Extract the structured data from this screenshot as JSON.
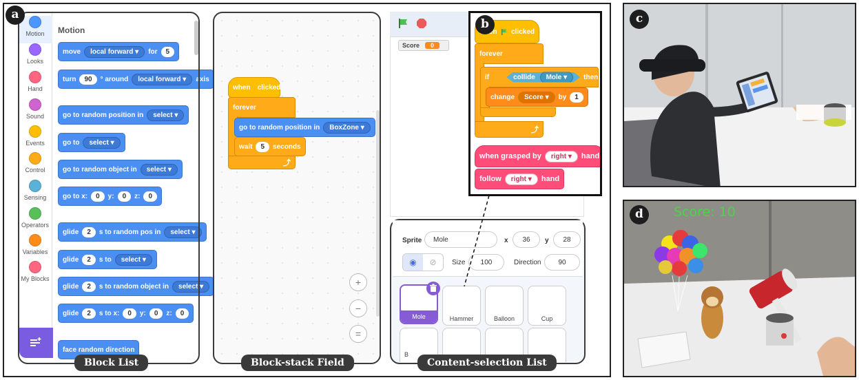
{
  "labels": {
    "a": "a",
    "b": "b",
    "c": "c",
    "d": "d",
    "block_list": "Block List",
    "block_stack_field": "Block-stack Field",
    "content_selection_list": "Content-selection List"
  },
  "categories": [
    {
      "label": "Motion",
      "color": "#4c97ff"
    },
    {
      "label": "Looks",
      "color": "#9966ff"
    },
    {
      "label": "Hand",
      "color": "#ff6680"
    },
    {
      "label": "Sound",
      "color": "#cf63cf"
    },
    {
      "label": "Events",
      "color": "#ffbf00"
    },
    {
      "label": "Control",
      "color": "#ffab19"
    },
    {
      "label": "Sensing",
      "color": "#5cb1d6"
    },
    {
      "label": "Operators",
      "color": "#59c059"
    },
    {
      "label": "Variables",
      "color": "#ff8c1a"
    },
    {
      "label": "My Blocks",
      "color": "#ff6680"
    }
  ],
  "block_list": {
    "title": "Motion",
    "move": {
      "text": "move",
      "dropdown": "local forward",
      "for": "for",
      "value": "5"
    },
    "turn": {
      "text": "turn",
      "value": "90",
      "around": "° around",
      "dropdown": "local forward",
      "axis": "axis"
    },
    "random_pos": {
      "text": "go to random position in",
      "dropdown": "select"
    },
    "goto": {
      "text": "go to",
      "dropdown": "select"
    },
    "random_obj": {
      "text": "go to random object in",
      "dropdown": "select"
    },
    "goto_xyz": {
      "text": "go to x:",
      "x": "0",
      "y_label": "y:",
      "y": "0",
      "z_label": "z:",
      "z": "0"
    },
    "glide_pos": {
      "text": "glide",
      "value": "2",
      "rest": "s to random pos in",
      "dropdown": "select"
    },
    "glide_to": {
      "text": "glide",
      "value": "2",
      "rest": "s to",
      "dropdown": "select"
    },
    "glide_obj": {
      "text": "glide",
      "value": "2",
      "rest": "s to random object in",
      "dropdown": "select"
    },
    "glide_xyz": {
      "text": "glide",
      "value": "2",
      "rest": "s to x:",
      "x": "0",
      "y_label": "y:",
      "y": "0",
      "z_label": "z:",
      "z": "0"
    },
    "face": {
      "text": "face random direction"
    }
  },
  "field": {
    "when": "when",
    "clicked": "clicked",
    "forever": "forever",
    "goto_text": "go to random position in",
    "goto_dropdown": "BoxZone",
    "wait": "wait",
    "wait_value": "5",
    "seconds": "seconds",
    "zoom_in": "+",
    "zoom_out": "−",
    "zoom_reset": "="
  },
  "stage": {
    "score_label": "Score",
    "score_value": "0"
  },
  "sprite_props": {
    "sprite_label": "Sprite",
    "sprite_name": "Mole",
    "x_label": "x",
    "x_value": "36",
    "y_label": "y",
    "y_value": "28",
    "size_label": "Size",
    "size_value": "100",
    "direction_label": "Direction",
    "direction_value": "90"
  },
  "sprites": [
    "Mole",
    "Hammer",
    "Balloon",
    "Cup"
  ],
  "sprite_partial": "B",
  "callout": {
    "when": "when",
    "clicked": "clicked",
    "forever": "forever",
    "if": "if",
    "collide": "collide",
    "collide_dropdown": "Mole",
    "then": "then",
    "change": "change",
    "change_dropdown": "Score",
    "by": "by",
    "by_value": "1",
    "grasped": "when grasped by",
    "grasped_dropdown": "right",
    "hand": "hand",
    "follow": "follow",
    "follow_dropdown": "right",
    "follow_hand": "hand"
  },
  "ar": {
    "score_text": "Score: 10"
  }
}
